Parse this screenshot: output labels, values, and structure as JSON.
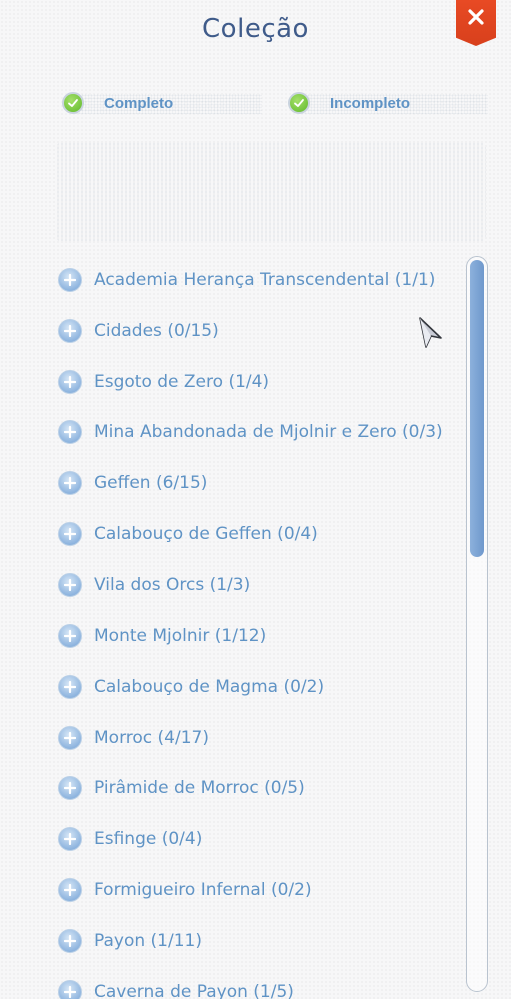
{
  "header": {
    "title": "Coleção",
    "close_icon": "close-icon"
  },
  "filters": [
    {
      "label": "Completo",
      "checked": true
    },
    {
      "label": "Incompleto",
      "checked": true
    }
  ],
  "collection": {
    "items": [
      {
        "label": "Academia Herança Transcendental (1/1)"
      },
      {
        "label": "Cidades (0/15)"
      },
      {
        "label": "Esgoto de Zero (1/4)"
      },
      {
        "label": "Mina Abandonada de Mjolnir e Zero (0/3)"
      },
      {
        "label": "Geffen (6/15)"
      },
      {
        "label": "Calabouço de Geffen (0/4)"
      },
      {
        "label": "Vila dos Orcs (1/3)"
      },
      {
        "label": "Monte Mjolnir (1/12)"
      },
      {
        "label": "Calabouço de Magma (0/2)"
      },
      {
        "label": "Morroc (4/17)"
      },
      {
        "label": "Pirâmide de Morroc (0/5)"
      },
      {
        "label": "Esfinge (0/4)"
      },
      {
        "label": "Formigueiro Infernal (0/2)"
      },
      {
        "label": "Payon (1/11)"
      },
      {
        "label": "Caverna de Payon (1/5)"
      }
    ]
  },
  "colors": {
    "accent": "#5f93c5",
    "title": "#3f5b8a",
    "close": "#e0441f",
    "check": "#6cc232"
  }
}
